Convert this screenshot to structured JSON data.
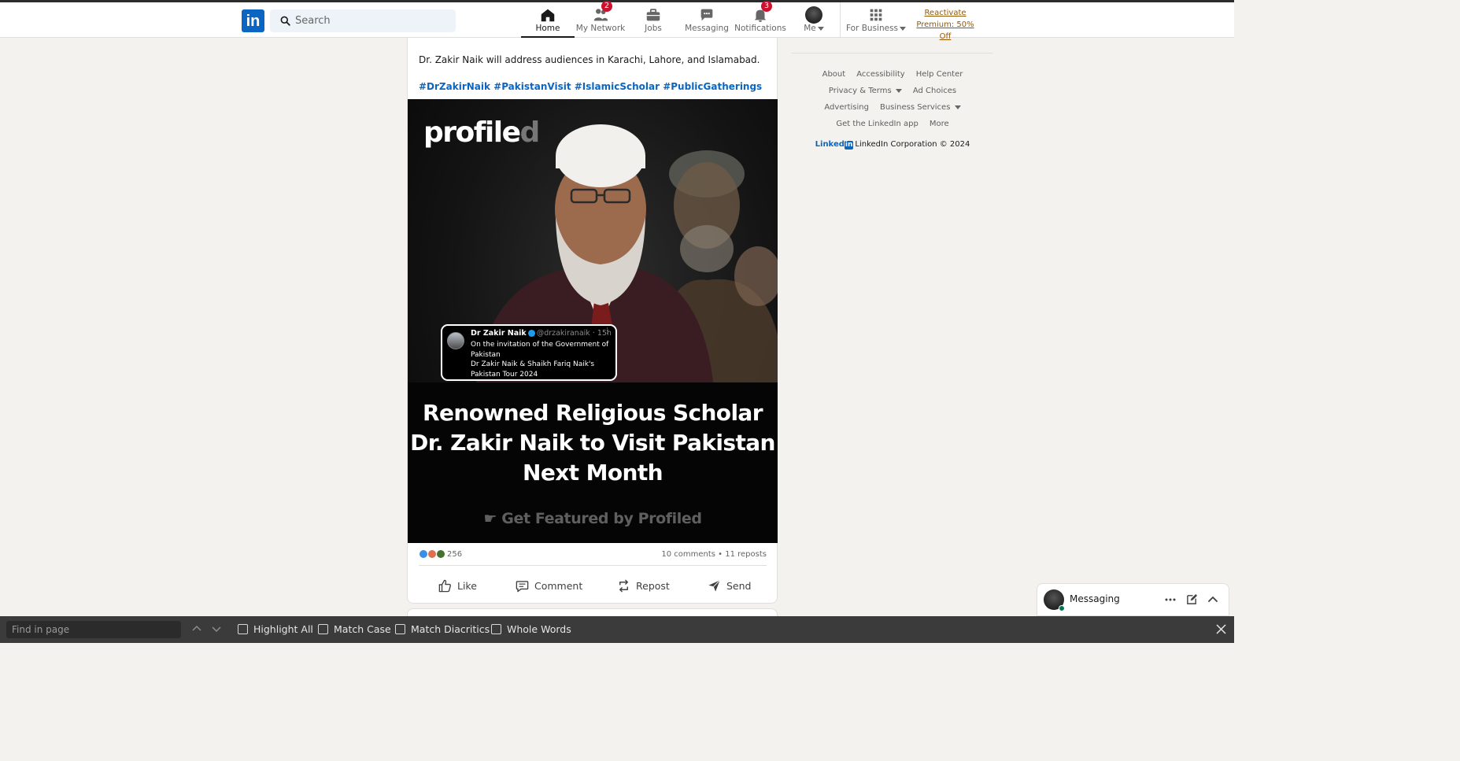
{
  "search": {
    "placeholder": "Search"
  },
  "nav": {
    "items": [
      {
        "label": "Home",
        "icon": "home-icon",
        "active": true
      },
      {
        "label": "My Network",
        "icon": "people-icon",
        "badge": "2"
      },
      {
        "label": "Jobs",
        "icon": "briefcase-icon"
      },
      {
        "label": "Messaging",
        "icon": "chat-icon"
      },
      {
        "label": "Notifications",
        "icon": "bell-icon",
        "badge": "3"
      },
      {
        "label": "Me",
        "icon": "avatar"
      },
      {
        "label": "For Business",
        "icon": "grid-icon"
      }
    ],
    "premium_line1": "Reactivate",
    "premium_line2": "Premium: 50% Off"
  },
  "post": {
    "text": "Dr. Zakir Naik will address audiences in Karachi, Lahore, and Islamabad.",
    "hashtags": "#DrZakirNaik #PakistanVisit #IslamicScholar #PublicGatherings",
    "image": {
      "brand": "profile",
      "brand_fade": "d",
      "tweet_name": "Dr Zakir Naik",
      "tweet_meta": "@drzakiranaik · 15h",
      "tweet_line1": "On the invitation of the Government of Pakistan",
      "tweet_line2": "Dr Zakir Naik & Shaikh Fariq Naik's Pakistan Tour 2024",
      "headline": "Renowned Religious Scholar Dr. Zakir Naik to Visit Pakistan Next Month",
      "cta": "Get Featured by Profiled"
    },
    "reaction_count": "256",
    "comments_reposts": "10 comments • 11 reposts",
    "actions": {
      "like": "Like",
      "comment": "Comment",
      "repost": "Repost",
      "send": "Send"
    }
  },
  "footer": {
    "row1": [
      "About",
      "Accessibility",
      "Help Center"
    ],
    "row2": [
      "Privacy & Terms",
      "Ad Choices"
    ],
    "row3": [
      "Advertising",
      "Business Services"
    ],
    "row4": [
      "Get the LinkedIn app",
      "More"
    ],
    "brand_word": "Linked",
    "brand_box": "in",
    "copyright": "LinkedIn Corporation © 2024"
  },
  "messaging": {
    "title": "Messaging"
  },
  "findbar": {
    "placeholder": "Find in page",
    "highlight_all": "Highlight All",
    "match_case": "Match Case",
    "match_diacritics": "Match Diacritics",
    "whole_words": "Whole Words"
  },
  "colors": {
    "brand": "#0a66c2",
    "badge": "#cb112d",
    "premium": "#915907",
    "findbar": "#3b3b3b"
  }
}
